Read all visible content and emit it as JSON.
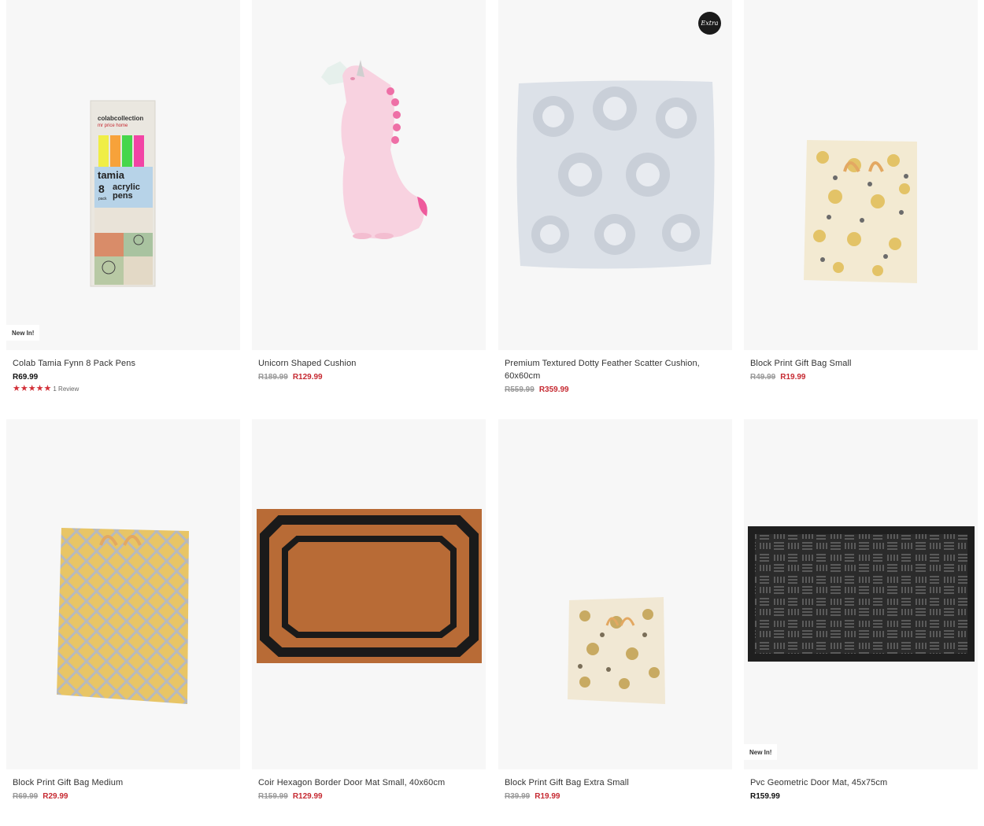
{
  "products": [
    {
      "title": "Colab Tamia Fynn 8 Pack Pens",
      "price": "R69.99",
      "badge": "New In!",
      "rating": {
        "stars": 5,
        "text": "1 Review"
      },
      "pack_text": {
        "brand": "colabcollection",
        "store": "mr price home",
        "name": "tamia",
        "count": "8",
        "pack": "pack",
        "desc1": "acrylic",
        "desc2": "pens"
      }
    },
    {
      "title": "Unicorn Shaped Cushion",
      "old_price": "R189.99",
      "sale_price": "R129.99"
    },
    {
      "title": "Premium Textured Dotty Feather Scatter Cushion, 60x60cm",
      "old_price": "R559.99",
      "sale_price": "R359.99",
      "extra_badge": "Extra"
    },
    {
      "title": "Block Print Gift Bag Small",
      "old_price": "R49.99",
      "sale_price": "R19.99"
    },
    {
      "title": "Block Print Gift Bag Medium",
      "old_price": "R69.99",
      "sale_price": "R29.99"
    },
    {
      "title": "Coir Hexagon Border Door Mat Small, 40x60cm",
      "old_price": "R159.99",
      "sale_price": "R129.99"
    },
    {
      "title": "Block Print Gift Bag Extra Small",
      "old_price": "R39.99",
      "sale_price": "R19.99"
    },
    {
      "title": "Pvc Geometric Door Mat, 45x75cm",
      "price": "R159.99",
      "badge": "New In!"
    }
  ],
  "colors": {
    "sale": "#c62a32",
    "old": "#9a9a9a",
    "card_bg": "#f7f7f7",
    "star": "#d23038"
  }
}
